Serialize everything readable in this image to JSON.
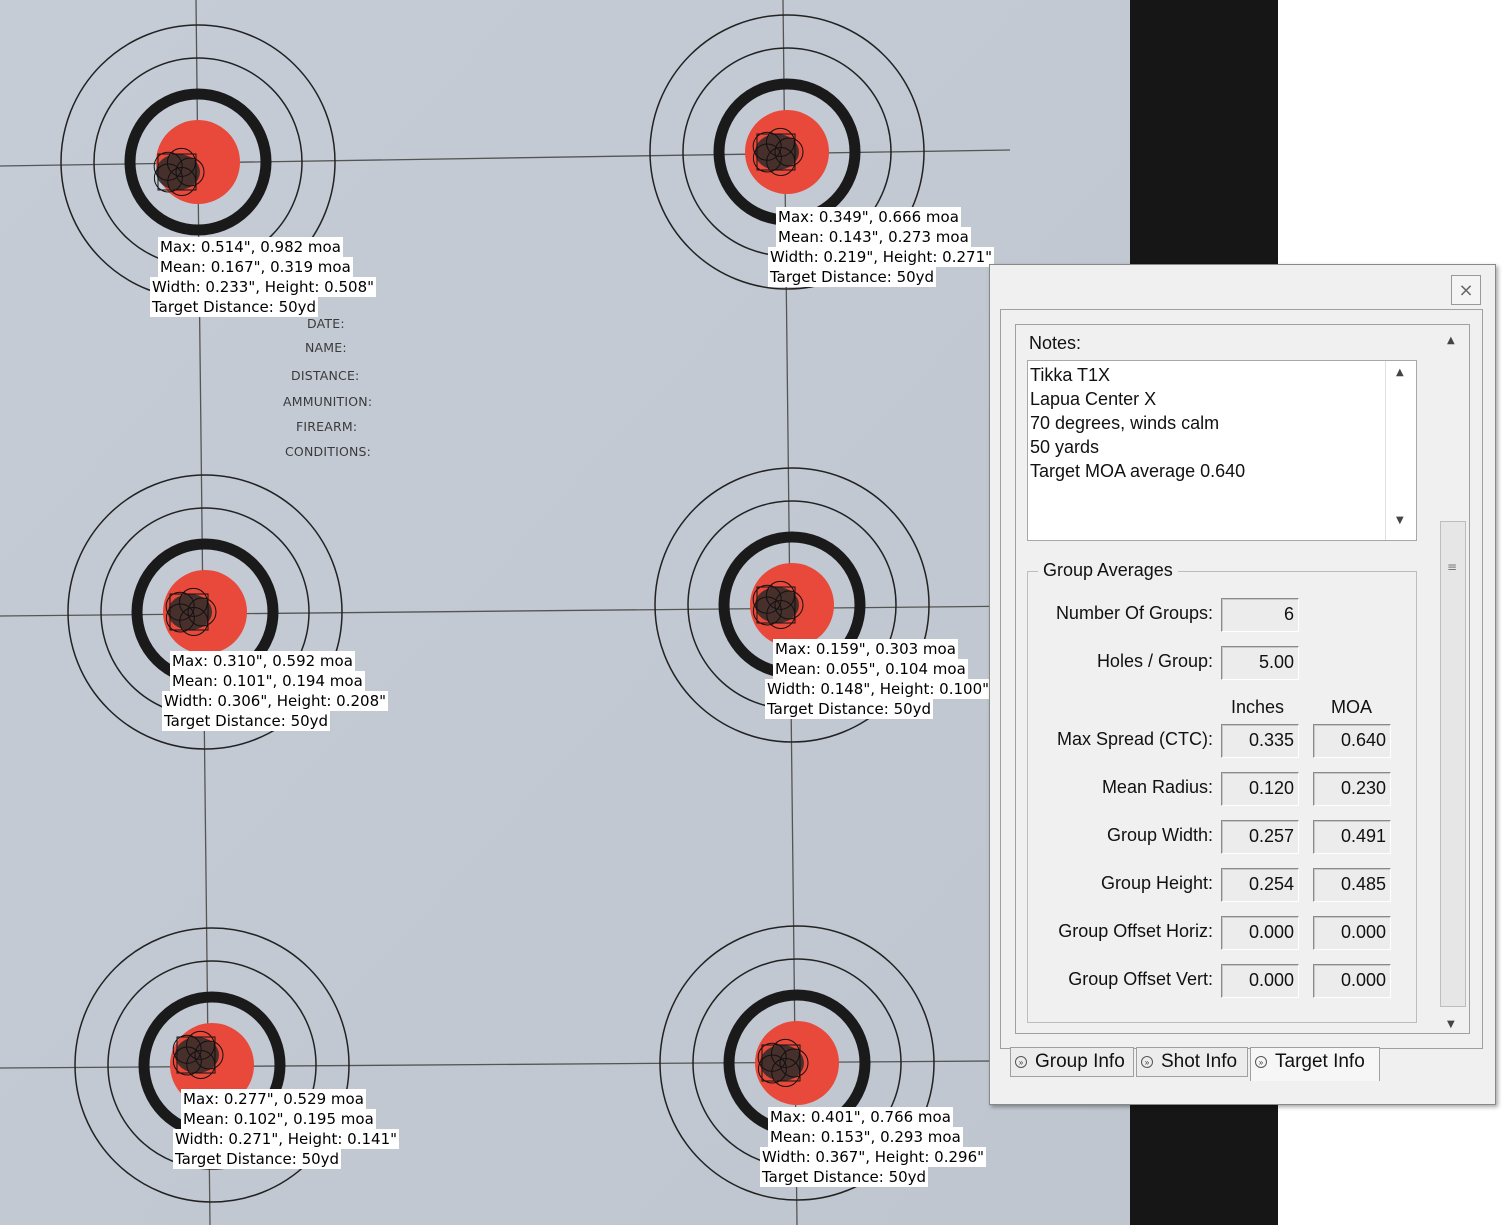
{
  "target_form": {
    "date": "DATE:",
    "name": "NAME:",
    "distance": "DISTANCE:",
    "ammunition": "AMMUNITION:",
    "firearm": "FIREARM:",
    "conditions": "CONDITIONS:"
  },
  "groups": [
    {
      "max": "Max: 0.514\", 0.982 moa",
      "mean": "Mean: 0.167\", 0.319 moa",
      "size": "Width: 0.233\", Height: 0.508\"",
      "distance": "Target Distance: 50yd"
    },
    {
      "max": "Max: 0.349\", 0.666 moa",
      "mean": "Mean: 0.143\", 0.273 moa",
      "size": "Width: 0.219\", Height: 0.271\"",
      "distance": "Target Distance: 50yd"
    },
    {
      "max": "Max: 0.310\", 0.592 moa",
      "mean": "Mean: 0.101\", 0.194 moa",
      "size": "Width: 0.306\", Height: 0.208\"",
      "distance": "Target Distance: 50yd"
    },
    {
      "max": "Max: 0.159\", 0.303 moa",
      "mean": "Mean: 0.055\", 0.104 moa",
      "size": "Width: 0.148\", Height: 0.100\"",
      "distance": "Target Distance: 50yd"
    },
    {
      "max": "Max: 0.277\", 0.529 moa",
      "mean": "Mean: 0.102\", 0.195 moa",
      "size": "Width: 0.271\", Height: 0.141\"",
      "distance": "Target Distance: 50yd"
    },
    {
      "max": "Max: 0.401\", 0.766 moa",
      "mean": "Mean: 0.153\", 0.293 moa",
      "size": "Width: 0.367\", Height: 0.296\"",
      "distance": "Target Distance: 50yd"
    }
  ],
  "panel": {
    "notes_label": "Notes:",
    "notes_text": "Tikka T1X\nLapua Center X\n70 degrees, winds calm\n50 yards\nTarget MOA average 0.640",
    "group_averages_label": "Group Averages",
    "number_of_groups_label": "Number Of Groups:",
    "number_of_groups": "6",
    "holes_per_group_label": "Holes / Group:",
    "holes_per_group": "5.00",
    "col_inches": "Inches",
    "col_moa": "MOA",
    "rows": [
      {
        "label": "Max Spread (CTC):",
        "inches": "0.335",
        "moa": "0.640"
      },
      {
        "label": "Mean Radius:",
        "inches": "0.120",
        "moa": "0.230"
      },
      {
        "label": "Group Width:",
        "inches": "0.257",
        "moa": "0.491"
      },
      {
        "label": "Group Height:",
        "inches": "0.254",
        "moa": "0.485"
      },
      {
        "label": "Group Offset Horiz:",
        "inches": "0.000",
        "moa": "0.000"
      },
      {
        "label": "Group Offset Vert:",
        "inches": "0.000",
        "moa": "0.000"
      }
    ],
    "tabs": [
      {
        "label": "Group Info",
        "active": false
      },
      {
        "label": "Shot Info",
        "active": false
      },
      {
        "label": "Target Info",
        "active": true
      }
    ]
  },
  "colors": {
    "paper": "#c3c9d3",
    "bullseye": "#e8493a",
    "ring": "#222222",
    "bar": "#111111"
  }
}
